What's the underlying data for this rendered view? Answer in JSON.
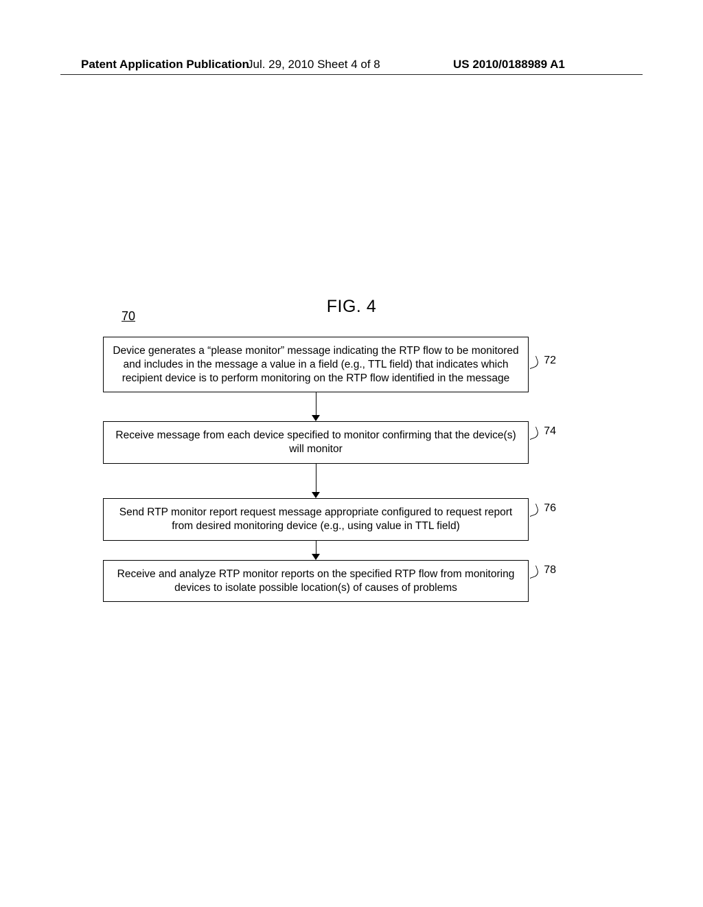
{
  "header": {
    "left": "Patent Application Publication",
    "center": "Jul. 29, 2010  Sheet 4 of 8",
    "right": "US 2010/0188989 A1"
  },
  "figure": {
    "title": "FIG. 4",
    "reference_numeral": "70"
  },
  "steps": [
    {
      "label": "72",
      "text": "Device generates a “please monitor” message indicating the RTP flow to be monitored and includes in the message a value in a field (e.g., TTL field) that indicates which recipient device is to perform monitoring on the RTP flow identified in the message"
    },
    {
      "label": "74",
      "text": "Receive message from each device specified to monitor confirming that the device(s) will monitor"
    },
    {
      "label": "76",
      "text": "Send RTP monitor report request message appropriate configured to request report from desired monitoring device (e.g., using value in TTL field)"
    },
    {
      "label": "78",
      "text": "Receive and analyze RTP monitor reports on the specified RTP flow from monitoring devices to isolate possible location(s) of causes of problems"
    }
  ]
}
